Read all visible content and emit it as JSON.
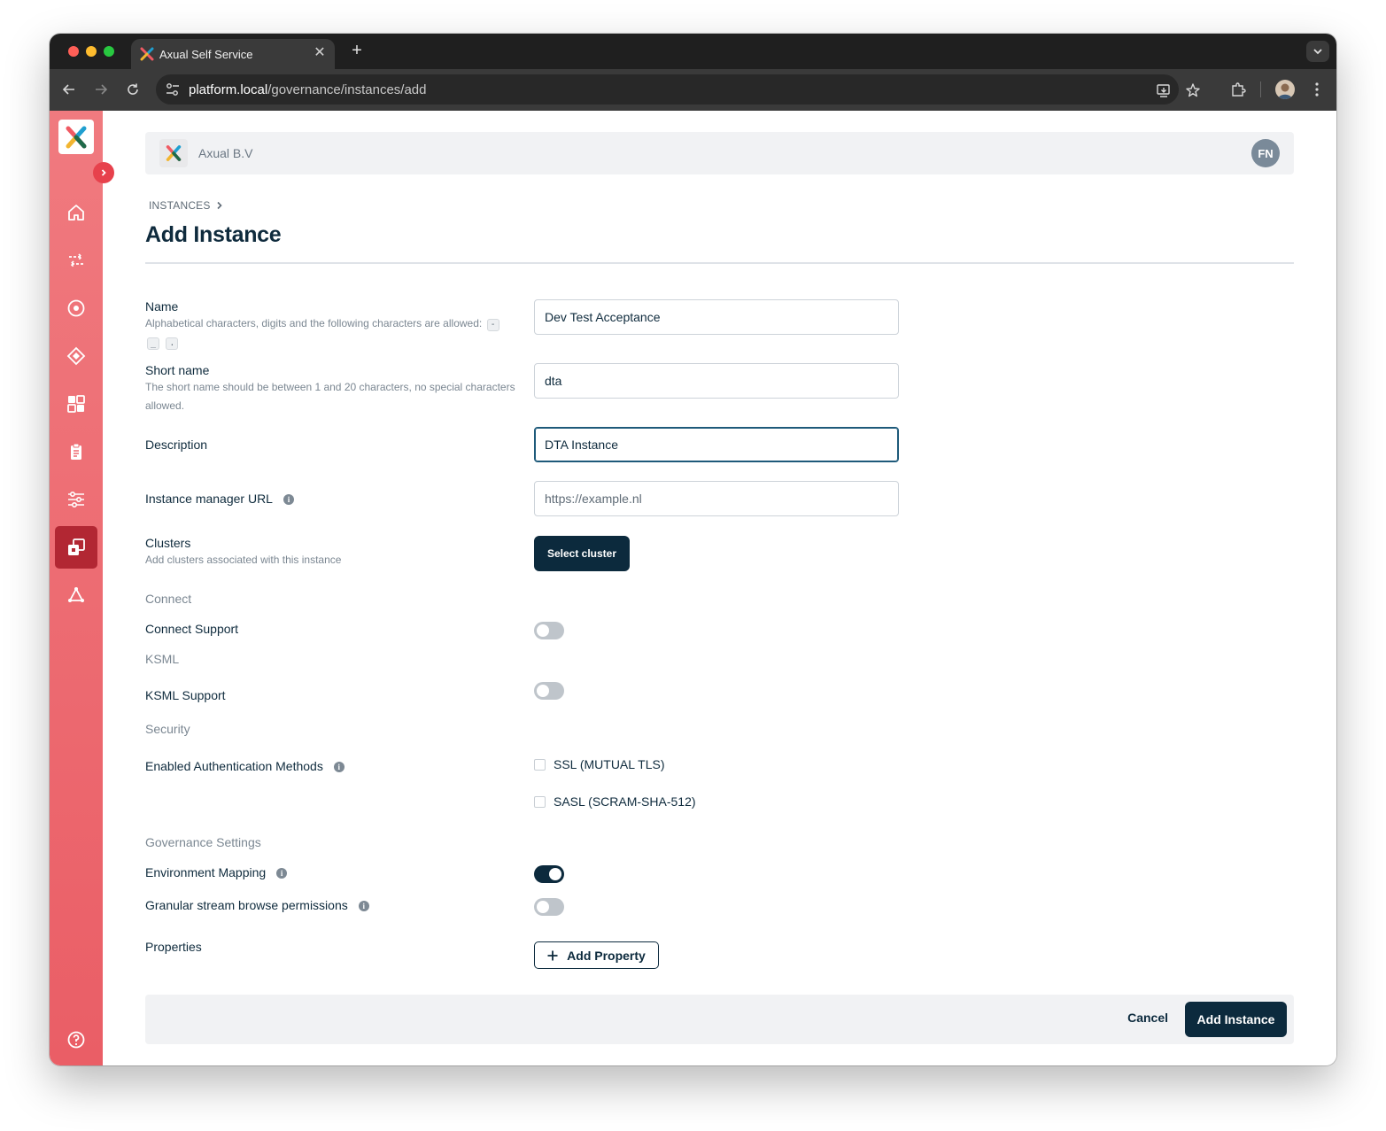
{
  "browser": {
    "tab_title": "Axual Self Service",
    "url_host": "platform.local",
    "url_path": "/governance/instances/add"
  },
  "header": {
    "org_name": "Axual B.V",
    "avatar_initials": "FN"
  },
  "breadcrumb": {
    "parent": "INSTANCES"
  },
  "page": {
    "title": "Add Instance"
  },
  "form": {
    "name": {
      "label": "Name",
      "hint": "Alphabetical characters, digits and the following characters are allowed:",
      "allowed_chars": [
        "-",
        "_",
        "."
      ],
      "value": "Dev Test Acceptance"
    },
    "short_name": {
      "label": "Short name",
      "hint": "The short name should be between 1 and 20 characters, no special characters allowed.",
      "value": "dta"
    },
    "description": {
      "label": "Description",
      "value": "DTA Instance"
    },
    "instance_manager_url": {
      "label": "Instance manager URL",
      "placeholder": "https://example.nl"
    },
    "clusters": {
      "label": "Clusters",
      "hint": "Add clusters associated with this instance",
      "button": "Select cluster"
    },
    "connect": {
      "section": "Connect",
      "label": "Connect Support",
      "enabled": false
    },
    "ksml": {
      "section": "KSML",
      "label": "KSML Support",
      "enabled": false
    },
    "security": {
      "section": "Security",
      "label": "Enabled Authentication Methods",
      "options": [
        {
          "label": "SSL (MUTUAL TLS)",
          "checked": false
        },
        {
          "label": "SASL (SCRAM-SHA-512)",
          "checked": false
        }
      ]
    },
    "governance": {
      "section": "Governance Settings",
      "environment_mapping": {
        "label": "Environment Mapping",
        "enabled": true
      },
      "granular_browse": {
        "label": "Granular stream browse permissions",
        "enabled": false
      }
    },
    "properties": {
      "label": "Properties",
      "button": "Add Property"
    }
  },
  "footer": {
    "cancel": "Cancel",
    "submit": "Add Instance"
  },
  "colors": {
    "sidebar_top": "#f07a7f",
    "sidebar_bottom": "#ea5e66",
    "sidebar_active": "#b22733",
    "primary": "#0c2a3d"
  }
}
